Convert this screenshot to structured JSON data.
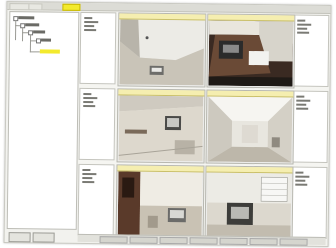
{
  "window": {
    "tabs": [
      {
        "label": "",
        "active": false
      },
      {
        "label": "",
        "active": false
      },
      {
        "label": "",
        "active": true
      }
    ]
  },
  "colors": {
    "accent_yellow": "#f3ea2d",
    "camera_title_bg": "#f5eeb0",
    "panel_bg": "#ffffff",
    "window_bg": "#f2f2ee"
  },
  "tree": {
    "selected_item": ""
  },
  "bottom_buttons": [
    "",
    ""
  ],
  "cameras": [
    {
      "title": "",
      "scene": "room-corner-white"
    },
    {
      "title": "",
      "scene": "room-dark-floor"
    },
    {
      "title": "",
      "scene": "room-overhead-objects"
    },
    {
      "title": "",
      "scene": "room-corridor-lit"
    },
    {
      "title": "",
      "scene": "room-door-dark"
    },
    {
      "title": "",
      "scene": "room-window-blinds"
    }
  ],
  "statusbar": {
    "items": [
      "",
      "",
      "",
      "",
      "",
      "",
      ""
    ]
  }
}
